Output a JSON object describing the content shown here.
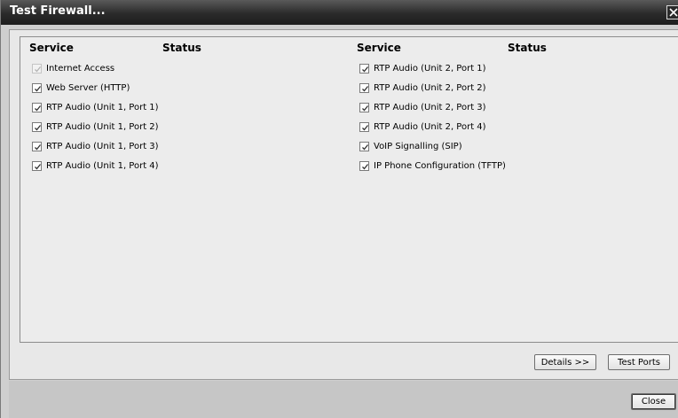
{
  "window": {
    "title": "Test Firewall..."
  },
  "columns": {
    "left": {
      "service": "Service",
      "status": "Status"
    },
    "right": {
      "service": "Service",
      "status": "Status"
    }
  },
  "services_left": [
    {
      "label": "Internet Access",
      "checked": true,
      "enabled": false
    },
    {
      "label": "Web Server (HTTP)",
      "checked": true,
      "enabled": true
    },
    {
      "label": "RTP Audio (Unit 1, Port 1)",
      "checked": true,
      "enabled": true
    },
    {
      "label": "RTP Audio (Unit 1, Port 2)",
      "checked": true,
      "enabled": true
    },
    {
      "label": "RTP Audio (Unit 1, Port 3)",
      "checked": true,
      "enabled": true
    },
    {
      "label": "RTP Audio (Unit 1, Port 4)",
      "checked": true,
      "enabled": true
    }
  ],
  "services_right": [
    {
      "label": "RTP Audio (Unit 2, Port 1)",
      "checked": true,
      "enabled": true
    },
    {
      "label": "RTP Audio (Unit 2, Port 2)",
      "checked": true,
      "enabled": true
    },
    {
      "label": "RTP Audio (Unit 2, Port 3)",
      "checked": true,
      "enabled": true
    },
    {
      "label": "RTP Audio (Unit 2, Port 4)",
      "checked": true,
      "enabled": true
    },
    {
      "label": "VoIP Signalling (SIP)",
      "checked": true,
      "enabled": true
    },
    {
      "label": "IP Phone Configuration (TFTP)",
      "checked": true,
      "enabled": true
    }
  ],
  "buttons": {
    "details": "Details >>",
    "test_ports": "Test Ports",
    "close": "Close"
  },
  "icons": {
    "close": "close-icon",
    "check": "checkmark-icon"
  }
}
